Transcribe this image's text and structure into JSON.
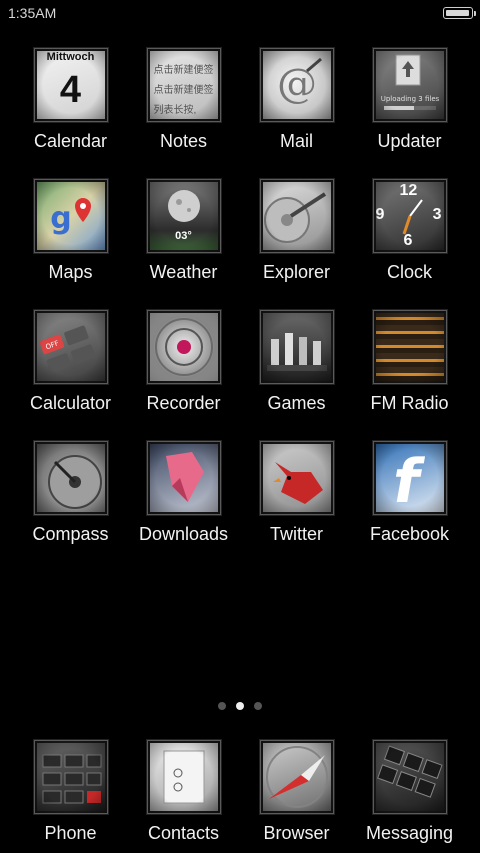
{
  "status_bar": {
    "time": "1:35AM",
    "battery_level": 0.95
  },
  "apps": [
    {
      "label": "Calendar",
      "icon": "calendar-icon"
    },
    {
      "label": "Notes",
      "icon": "notes-icon"
    },
    {
      "label": "Mail",
      "icon": "mail-icon"
    },
    {
      "label": "Updater",
      "icon": "updater-icon"
    },
    {
      "label": "Maps",
      "icon": "maps-icon"
    },
    {
      "label": "Weather",
      "icon": "weather-icon"
    },
    {
      "label": "Explorer",
      "icon": "explorer-icon"
    },
    {
      "label": "Clock",
      "icon": "clock-icon"
    },
    {
      "label": "Calculator",
      "icon": "calculator-icon"
    },
    {
      "label": "Recorder",
      "icon": "recorder-icon"
    },
    {
      "label": "Games",
      "icon": "games-icon"
    },
    {
      "label": "FM Radio",
      "icon": "fm-radio-icon"
    },
    {
      "label": "Compass",
      "icon": "compass-icon"
    },
    {
      "label": "Downloads",
      "icon": "downloads-icon"
    },
    {
      "label": "Twitter",
      "icon": "twitter-icon"
    },
    {
      "label": "Facebook",
      "icon": "facebook-icon"
    }
  ],
  "icon_text": {
    "calendar_weekday": "Mittwoch",
    "calendar_date": "4",
    "notes_lines": [
      "点击新建便签",
      "点击新建便签",
      "列表长按,"
    ],
    "updater_text": "Uploading 3 files",
    "weather_temp": "03°",
    "clock_numbers": [
      "12",
      "9",
      "3",
      "6"
    ],
    "calculator_key": "OFF"
  },
  "pager": {
    "pages": 3,
    "current": 2
  },
  "dock": [
    {
      "label": "Phone",
      "icon": "phone-icon"
    },
    {
      "label": "Contacts",
      "icon": "contacts-icon"
    },
    {
      "label": "Browser",
      "icon": "browser-icon"
    },
    {
      "label": "Messaging",
      "icon": "messaging-icon"
    }
  ],
  "colors": {
    "background": "#000000",
    "label": "#f2f2f2",
    "dot_active": "#eeeeee",
    "dot_inactive": "#555555"
  }
}
